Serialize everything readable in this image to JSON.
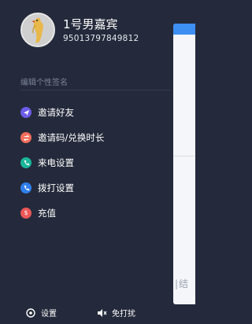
{
  "profile": {
    "name": "1号男嘉宾",
    "number": "95013797849812"
  },
  "signature_placeholder": "编辑个性签名",
  "menu": [
    {
      "label": "邀请好友",
      "icon": "send-icon",
      "color": "#6c5ce7"
    },
    {
      "label": "邀请码/兑换时长",
      "icon": "exchange-icon",
      "color": "#f26d5b"
    },
    {
      "label": "来电设置",
      "icon": "phone-icon",
      "color": "#1bb59a"
    },
    {
      "label": "拨打设置",
      "icon": "dial-icon",
      "color": "#2f80ed"
    },
    {
      "label": "充值",
      "icon": "dollar-icon",
      "color": "#eb5757"
    }
  ],
  "bottom": {
    "settings_label": "设置",
    "dnd_label": "免打扰"
  },
  "main_peek": {
    "footer_text": "|结"
  },
  "colors": {
    "drawer_bg": "#242a3b",
    "accent": "#3d8ff2"
  }
}
